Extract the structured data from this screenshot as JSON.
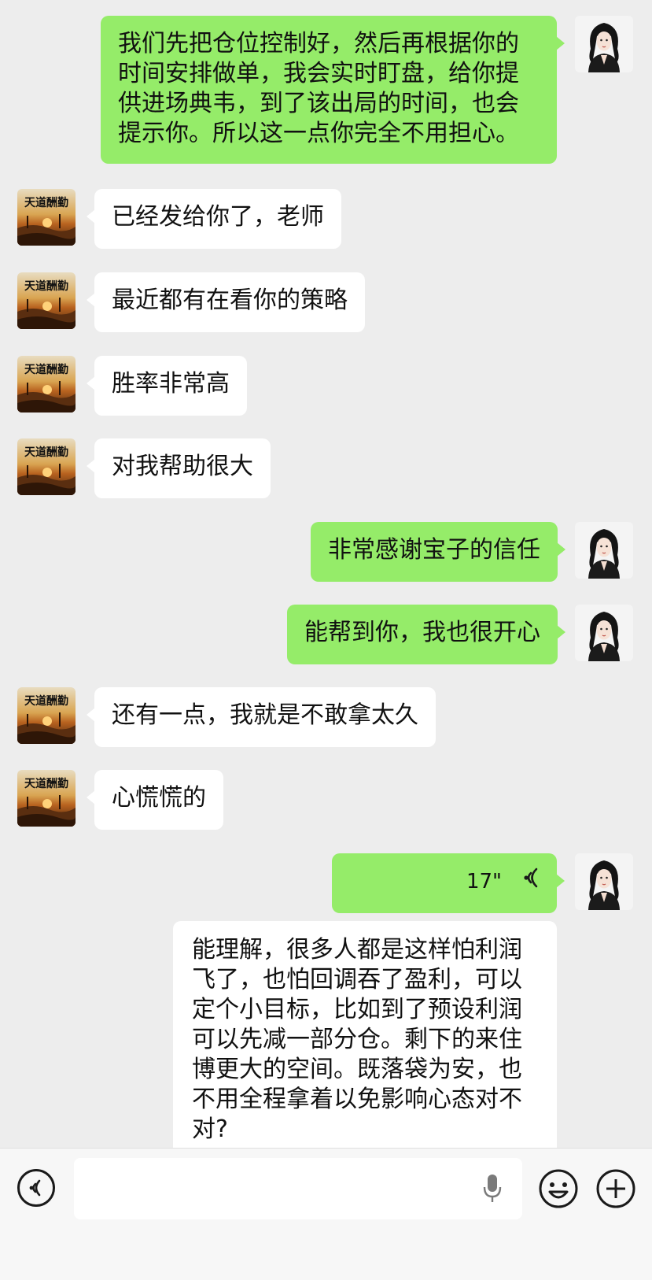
{
  "contacts": {
    "other_avatar_text": "天道酬勤",
    "self_avatar": "woman-portrait"
  },
  "messages": [
    {
      "side": "out",
      "type": "text",
      "lines": [
        "我们先把仓位控制好，然后再根据你的",
        "时间安排做单，我会实时盯盘，给你提",
        "供进场典韦，到了该出局的时间，也会",
        "提示你。所以这一点你完全不用担心。"
      ]
    },
    {
      "side": "in",
      "type": "text",
      "lines": [
        "已经发给你了，老师"
      ]
    },
    {
      "side": "in",
      "type": "text",
      "lines": [
        "最近都有在看你的策略"
      ]
    },
    {
      "side": "in",
      "type": "text",
      "lines": [
        "胜率非常高"
      ]
    },
    {
      "side": "in",
      "type": "text",
      "lines": [
        "对我帮助很大"
      ]
    },
    {
      "side": "out",
      "type": "text",
      "lines": [
        "非常感谢宝子的信任"
      ]
    },
    {
      "side": "out",
      "type": "text",
      "lines": [
        "能帮到你，我也很开心"
      ]
    },
    {
      "side": "in",
      "type": "text",
      "lines": [
        "还有一点，我就是不敢拿太久"
      ]
    },
    {
      "side": "in",
      "type": "text",
      "lines": [
        "心慌慌的"
      ]
    },
    {
      "side": "out",
      "type": "voice",
      "duration": "17\""
    },
    {
      "side": "out",
      "type": "transcript",
      "lines": [
        "能理解，很多人都是这样怕利润",
        "飞了，也怕回调吞了盈利，可以",
        "定个小目标，比如到了预设利润",
        "可以先减一部分仓。剩下的来住",
        "博更大的空间。既落袋为安，也",
        "不用全程拿着以免影响心态对不",
        "对?"
      ]
    }
  ],
  "input_bar": {
    "voice_icon": "voice-mode-icon",
    "mic_icon": "microphone-icon",
    "emoji_icon": "emoji-icon",
    "plus_icon": "plus-icon"
  },
  "colors": {
    "background": "#ededed",
    "outgoing_bubble": "#95ec69",
    "incoming_bubble": "#ffffff"
  }
}
